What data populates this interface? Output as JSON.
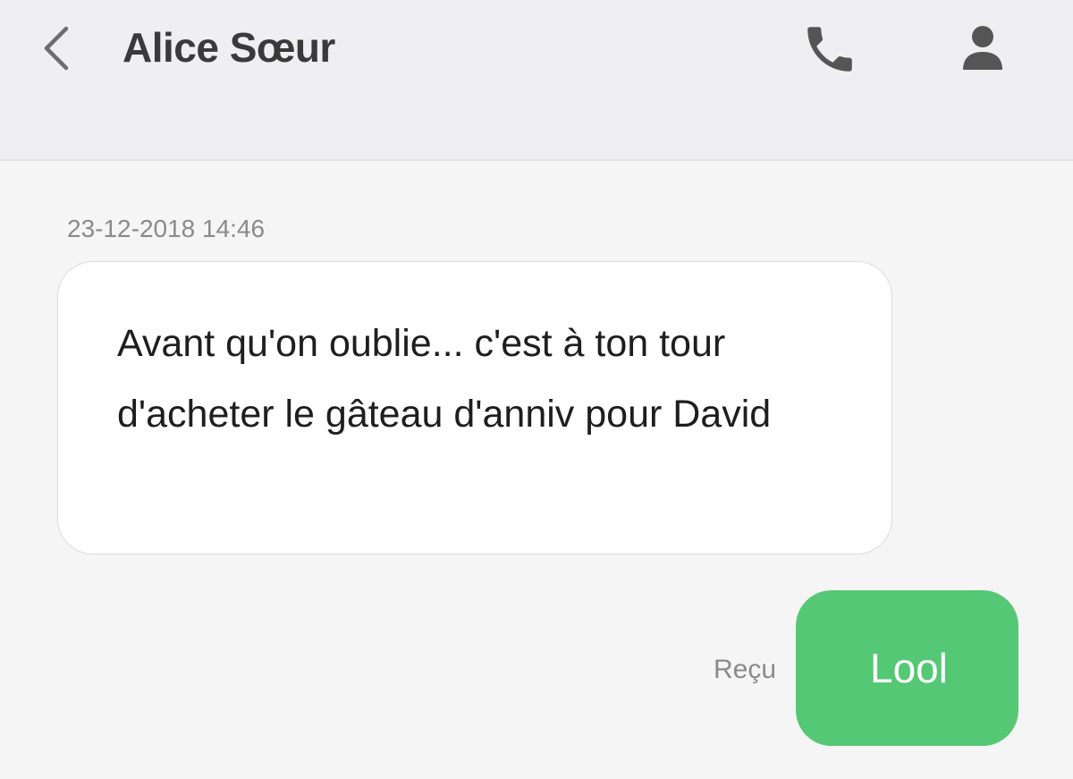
{
  "header": {
    "contact_name": "Alice Sœur",
    "back_icon": "chevron-left-icon",
    "call_icon": "phone-icon",
    "contact_icon": "person-icon",
    "background_color": "#efeff1"
  },
  "conversation": {
    "timestamp": "23-12-2018 14:46",
    "messages": [
      {
        "direction": "incoming",
        "text": "Avant qu'on oublie... c'est à ton tour d'acheter le gâteau d'anniv pour David",
        "bubble_color": "#ffffff"
      },
      {
        "direction": "outgoing",
        "text": "Lool",
        "status": "Reçu",
        "bubble_color": "#54c874"
      }
    ]
  }
}
